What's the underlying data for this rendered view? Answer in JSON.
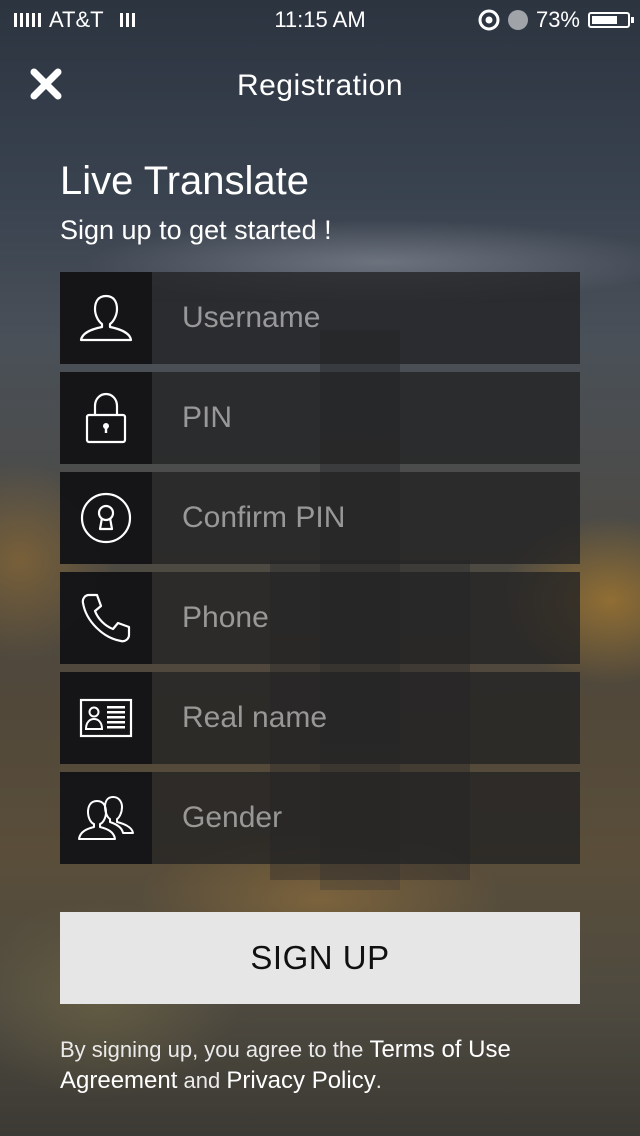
{
  "status_bar": {
    "carrier": "AT&T",
    "time": "11:15 AM",
    "battery": "73%",
    "battery_level": 0.73
  },
  "nav": {
    "title": "Registration",
    "close_icon": "close-icon"
  },
  "header": {
    "title": "Live Translate",
    "subtitle": "Sign up to get started !"
  },
  "form": {
    "fields": [
      {
        "icon": "user-icon",
        "placeholder": "Username"
      },
      {
        "icon": "lock-icon",
        "placeholder": "PIN"
      },
      {
        "icon": "keyhole-icon",
        "placeholder": "Confirm PIN"
      },
      {
        "icon": "phone-icon",
        "placeholder": "Phone"
      },
      {
        "icon": "id-card-icon",
        "placeholder": "Real name"
      },
      {
        "icon": "users-icon",
        "placeholder": "Gender"
      }
    ],
    "submit_label": "SIGN UP"
  },
  "legal": {
    "prefix": "By signing up, you agree to the ",
    "terms_link": "Terms of Use Agreement",
    "joiner": " and ",
    "privacy_link": "Privacy Policy",
    "suffix": "."
  },
  "colors": {
    "button_bg": "#e6e6e6",
    "field_bg": "#222224",
    "icon_box_bg": "#121214"
  }
}
